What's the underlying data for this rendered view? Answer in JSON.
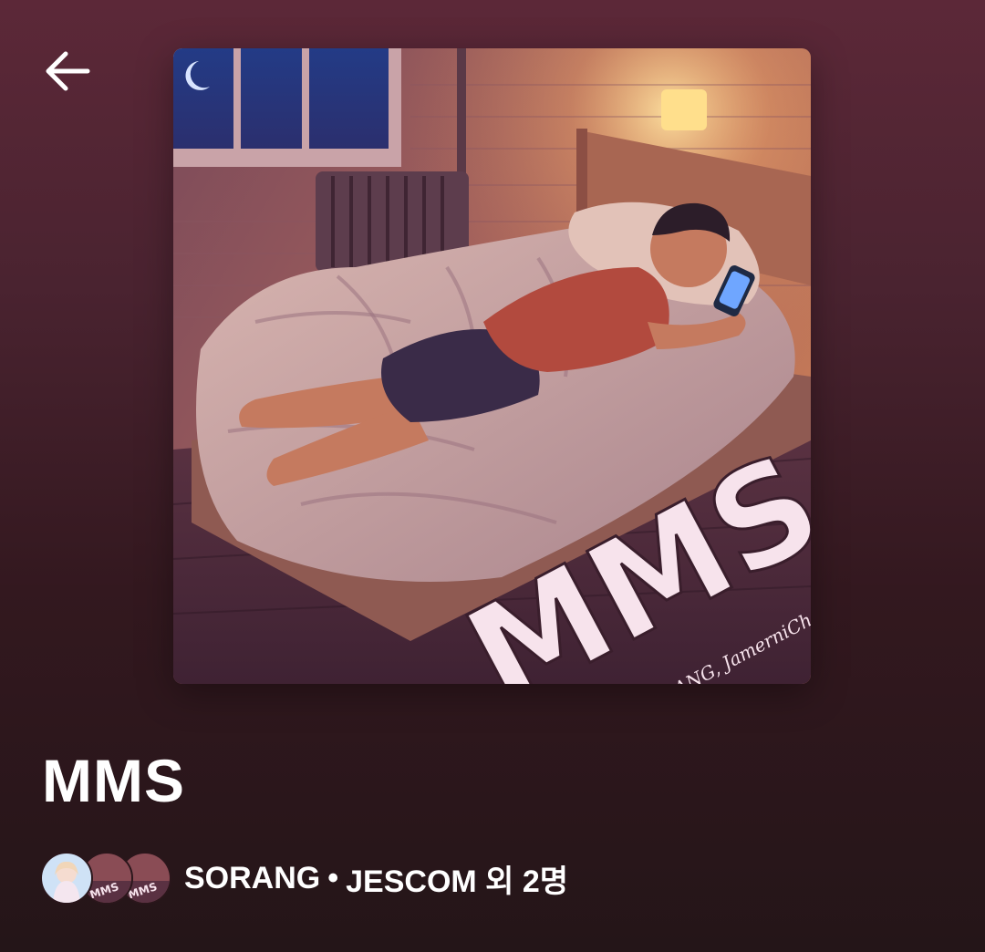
{
  "header": {
    "back_icon": "arrow-left-icon"
  },
  "album": {
    "cover_title": "MMS",
    "cover_credits": "JESCOM, SORANG, JamerniChoi, Cenopus",
    "title": "MMS"
  },
  "artists": {
    "primary": "SORANG",
    "separator": "•",
    "rest": "JESCOM 외 2명",
    "avatar_badge": "MMS"
  },
  "colors": {
    "background_top": "#5c2838",
    "background_bottom": "#241518",
    "text": "#ffffff"
  }
}
